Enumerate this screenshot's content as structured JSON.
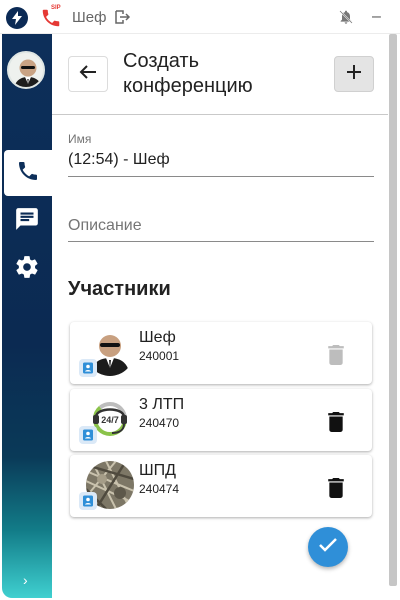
{
  "titlebar": {
    "sip_label": "SIP",
    "user_name": "Шеф",
    "minimize_label": "–"
  },
  "sidebar": {
    "items": [
      {
        "name": "phone",
        "icon": "phone-icon",
        "active": true
      },
      {
        "name": "chat",
        "icon": "chat-icon",
        "active": false
      },
      {
        "name": "settings",
        "icon": "gear-icon",
        "active": false
      }
    ],
    "expand_label": "›"
  },
  "header": {
    "title": "Создать конференцию",
    "back_icon": "arrow-left-icon",
    "add_icon": "plus-icon"
  },
  "form": {
    "name_label": "Имя",
    "name_value": "(12:54) - Шеф",
    "description_placeholder": "Описание"
  },
  "participants": {
    "title": "Участники",
    "items": [
      {
        "name": "Шеф",
        "number": "240001",
        "delete_enabled": false
      },
      {
        "name": "3 ЛТП",
        "number": "240470",
        "delete_enabled": true
      },
      {
        "name": "ШПД",
        "number": "240474",
        "delete_enabled": true
      }
    ]
  },
  "colors": {
    "sidebar_top": "#0d2f5a",
    "sidebar_bottom": "#3fd0d0",
    "accent": "#2f8fd8",
    "sip_red": "#e53935"
  }
}
